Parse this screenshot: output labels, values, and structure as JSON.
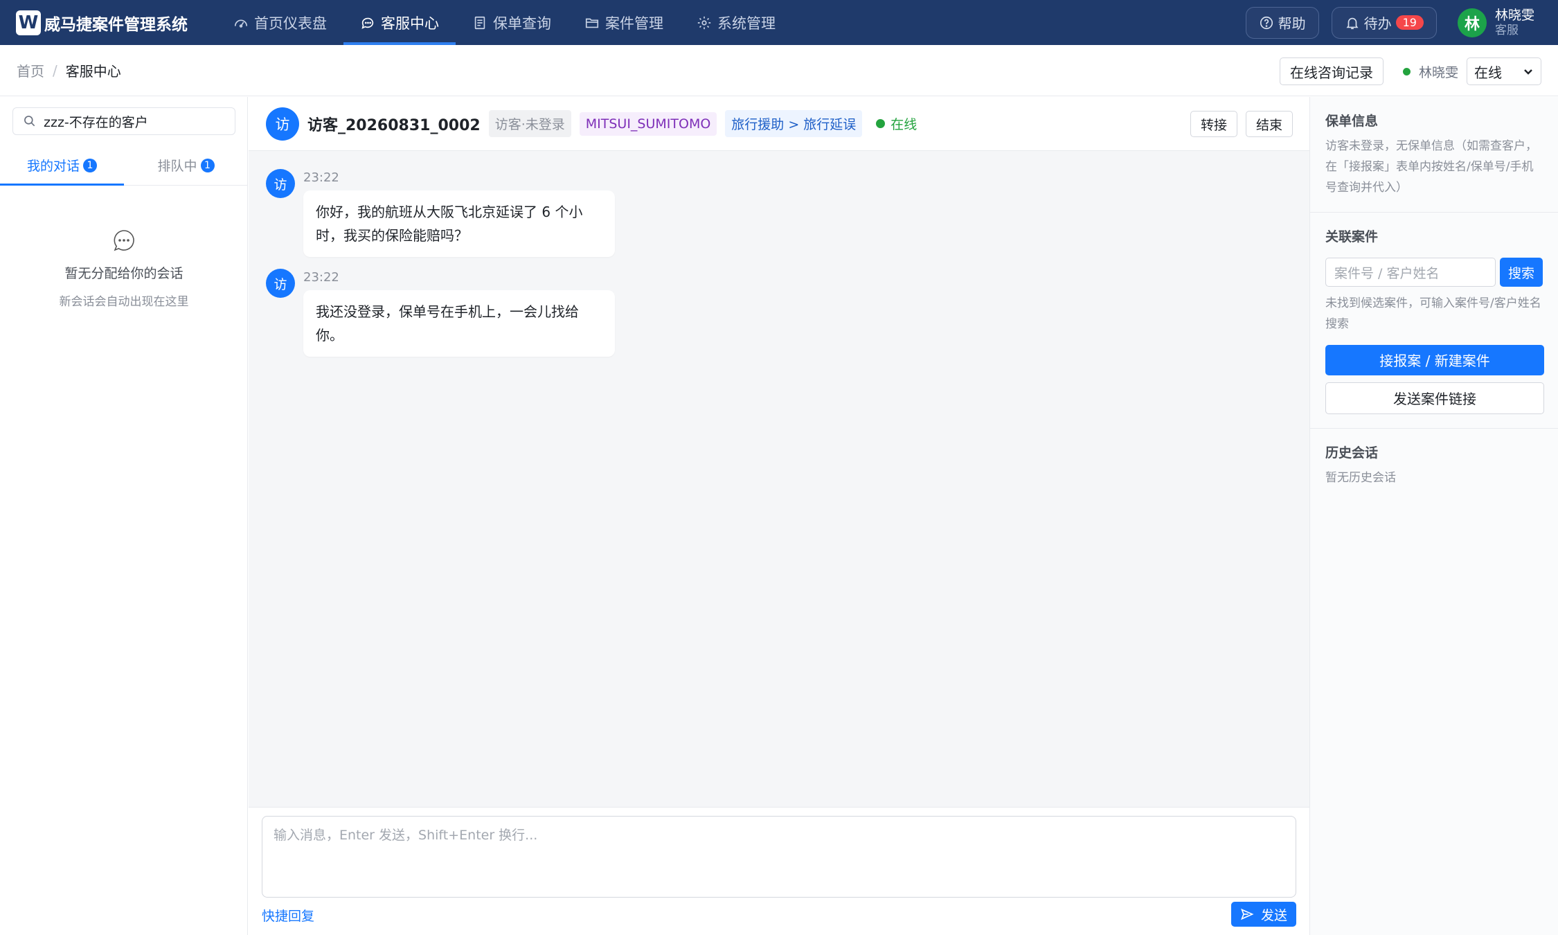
{
  "app": {
    "logo_letter": "W",
    "title": "威马捷案件管理系统"
  },
  "nav": [
    {
      "label": "首页仪表盘",
      "icon": "dashboard-icon"
    },
    {
      "label": "客服中心",
      "icon": "chat-icon",
      "active": true
    },
    {
      "label": "保单查询",
      "icon": "document-icon"
    },
    {
      "label": "案件管理",
      "icon": "folder-icon"
    },
    {
      "label": "系统管理",
      "icon": "gear-icon"
    }
  ],
  "top_right": {
    "help_label": "帮助",
    "todo_label": "待办",
    "todo_count": "19",
    "user_initial": "林",
    "user_name": "林晓雯",
    "user_role": "客服"
  },
  "breadcrumb": {
    "home": "首页",
    "separator": "/",
    "current": "客服中心"
  },
  "toolbar": {
    "records_label": "在线咨询记录",
    "agent_name": "林晓雯",
    "status_value": "在线"
  },
  "left": {
    "search_value": "zzz-不存在的客户",
    "tabs": [
      {
        "label": "我的对话",
        "count": "1"
      },
      {
        "label": "排队中",
        "count": "1"
      }
    ],
    "empty_title": "暂无分配给你的会话",
    "empty_sub": "新会话会自动出现在这里"
  },
  "chat": {
    "avatar_text": "访",
    "visitor_name": "访客_20260831_0002",
    "tag_login": "访客·未登录",
    "tag_insurer": "MITSUI_SUMITOMO",
    "tag_category": "旅行援助 > 旅行延误",
    "status": "在线",
    "transfer_label": "转接",
    "end_label": "结束",
    "messages": [
      {
        "avatar": "访",
        "time": "23:22",
        "text": "你好，我的航班从大阪飞北京延误了 6 个小时，我买的保险能赔吗？"
      },
      {
        "avatar": "访",
        "time": "23:22",
        "text": "我还没登录，保单号在手机上，一会儿找给你。"
      }
    ],
    "input_placeholder": "输入消息，Enter 发送，Shift+Enter 换行...",
    "quick_reply_label": "快捷回复",
    "send_label": "发送"
  },
  "right": {
    "policy_title": "保单信息",
    "policy_text": "访客未登录，无保单信息（如需查客户，在「接报案」表单内按姓名/保单号/手机号查询并代入）",
    "case_title": "关联案件",
    "case_placeholder": "案件号 / 客户姓名",
    "case_search_label": "搜索",
    "case_hint": "未找到候选案件，可输入案件号/客户姓名搜索",
    "new_case_label": "接报案 / 新建案件",
    "send_link_label": "发送案件链接",
    "history_title": "历史会话",
    "history_text": "暂无历史会话"
  },
  "colors": {
    "nav_bg": "#1f3a6b",
    "accent": "#1677ff",
    "online": "#23a33e",
    "todo_badge": "#f5474a"
  }
}
